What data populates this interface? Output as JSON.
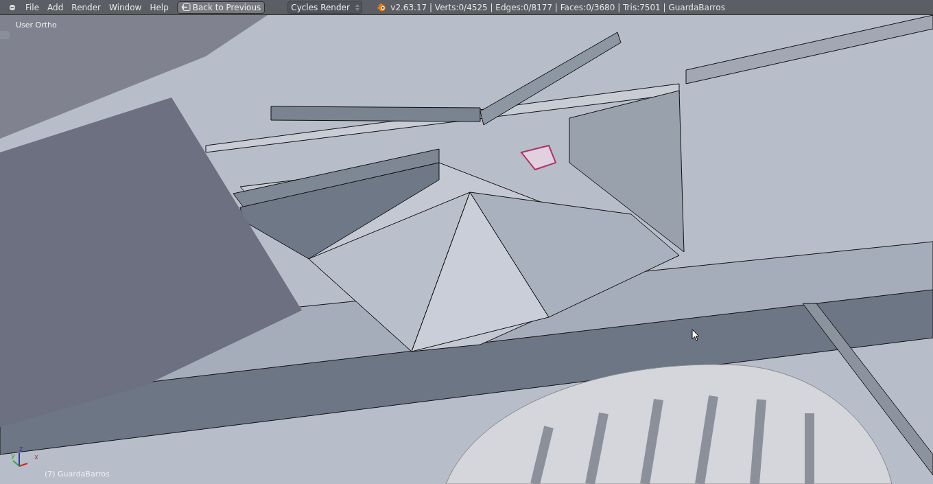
{
  "header": {
    "menu_items": [
      "File",
      "Add",
      "Render",
      "Window",
      "Help"
    ],
    "back_button": "Back to Previous",
    "render_engine": "Cycles Render",
    "stats": "v2.63.17 | Verts:0/4525 | Edges:0/8177 | Faces:0/3680 | Tris:7501 | GuardaBarros"
  },
  "viewport": {
    "view_label": "User Ortho",
    "object_label": "(7) GuardaBarros",
    "axes": [
      "z",
      "y",
      "x"
    ]
  }
}
